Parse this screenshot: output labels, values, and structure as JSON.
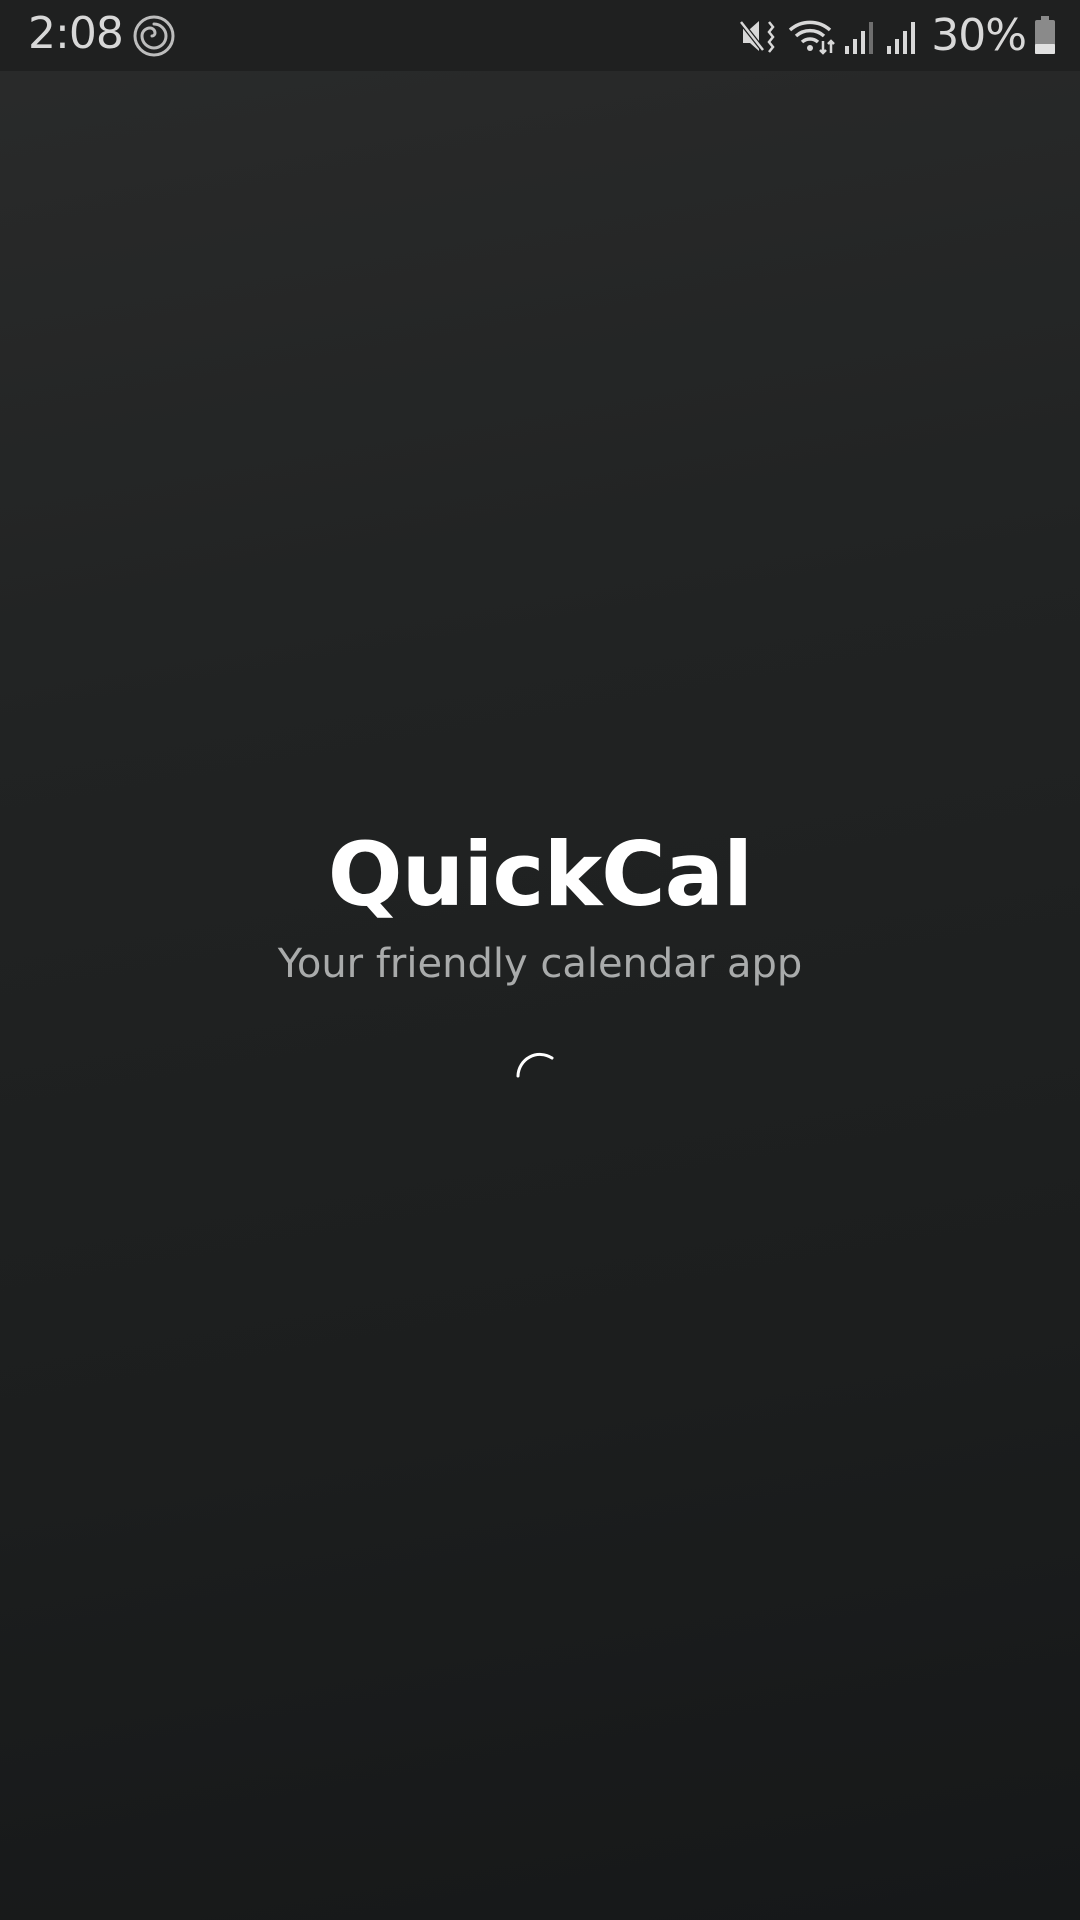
{
  "status_bar": {
    "time": "2:08",
    "battery_percent": "30%",
    "icons": [
      "spiral-app-icon",
      "mute-vibrate-icon",
      "wifi-icon",
      "signal-icon",
      "signal-icon",
      "battery-icon"
    ],
    "battery_level": 0.3
  },
  "splash": {
    "title": "QuickCal",
    "tagline": "Your friendly calendar app",
    "loading": true
  },
  "colors": {
    "background_top": "#2a2b2b",
    "background_bottom": "#161819",
    "title": "#ffffff",
    "tagline": "#a9abab",
    "status_text": "#d8d8d8"
  }
}
